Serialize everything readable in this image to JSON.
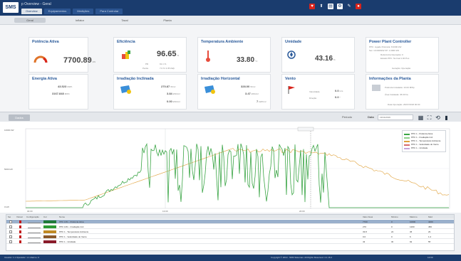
{
  "window": {
    "logo": "SMS",
    "title": "p Overview - Geral"
  },
  "nav": {
    "tabs": [
      "Overview",
      "Equipamentos",
      "Medições",
      "Para Controlar"
    ]
  },
  "subtabs": [
    "Geral",
    "Inflator",
    "Taxal",
    "Planta"
  ],
  "cards": {
    "potencia": {
      "title": "Potência Ativa",
      "value": "7700.89",
      "unit": "kW"
    },
    "eficiencia": {
      "title": "Eficiência",
      "value": "96.65",
      "unit": "%",
      "l1": "PR",
      "v1": "91.1 %",
      "l2": "Perda",
      "v2": "7.0 %  3.35 kWp"
    },
    "temperatura": {
      "title": "Temperatura Ambiente",
      "value": "33.80",
      "unit": "°C"
    },
    "umidade": {
      "title": "Umidade",
      "value": "43.16",
      "unit": "%"
    },
    "energia": {
      "title": "Energia Ativa",
      "v1": "43.523",
      "u1": "MWh",
      "v2": "3167.848",
      "u2": "MWh"
    },
    "irr_inc": {
      "title": "Irradiação Inclinada",
      "v1": "270.87",
      "u1": "W/m²",
      "v2": "3.84",
      "u2": "kWh/m²",
      "v3": "0.00",
      "u3": "kWh/m²"
    },
    "irr_hor": {
      "title": "Irradiação Horizontal",
      "v1": "328.00",
      "u1": "W/m²",
      "v2": "3.47",
      "u2": "kWh/m²",
      "v3": "7",
      "u3": "kWh/m²"
    },
    "vento": {
      "title": "Vento",
      "l1": "Velocidade",
      "v1": "0.0",
      "u1": "m/s",
      "l2": "Direção",
      "v2": "0.0",
      "u2": "°"
    },
    "ppc": {
      "title": "Power Plant Controller",
      "rows": [
        "PPC: Ligado   Potência: 8.0000 kW",
        "Set: 10.0000kW   FP: 1.0000 kW",
        "Referência Operação: 0",
        "Estado PPC: Normal 1.00 Pos"
      ],
      "footer": "Geração: Operação"
    },
    "info": {
      "title": "Informações da Planta",
      "rows": [
        "Potência Instalada: 10.00 MWp",
        "Área Instalada: 45.00 ha",
        "Data Operação: 26/07/2018 00:00"
      ]
    }
  },
  "chart_toolbar": {
    "data_button": "Dados",
    "date_label": "Data",
    "date_value": "13/11/2019",
    "period": "Período"
  },
  "chart_data": {
    "type": "line",
    "x": [
      "04:00",
      "13:00",
      "20:00"
    ],
    "series": [
      {
        "name": "PPC 1 - Potência Ativa",
        "color": "#3aa545"
      },
      {
        "name": "PPC 1 - Irradiação Incl.",
        "color": "#8ccf8a"
      },
      {
        "name": "PPC 1 - Temperatura Ambiente",
        "color": "#e0a13a"
      },
      {
        "name": "PPC 1 - Velocidade do Vento",
        "color": "#d66a6a"
      },
      {
        "name": "PPC 1 - Umidade",
        "color": "#c7a3d8"
      }
    ],
    "y_ticks": [
      "10000 kW",
      "5000 kW",
      "0 kW"
    ]
  },
  "grid": {
    "headers": [
      "Sel",
      "Visível",
      "Configuração",
      "Cor",
      "Nome",
      "Valor Atual",
      "Mínimo",
      "Máximo",
      "Méd"
    ],
    "rows": [
      {
        "name": "PPC 1/01 - Potência Ativa",
        "color": "#1f7a3a",
        "val": "7700",
        "min": "0",
        "max": "10000",
        "avg": "4460"
      },
      {
        "name": "PPC 1/01 - Irradiação Incl.",
        "color": "#2e9a35",
        "val": "270",
        "min": "0",
        "max": "1200",
        "avg": "450"
      },
      {
        "name": "PPC 1 - Temperatura Ambiente",
        "color": "#c08a24",
        "val": "33.8",
        "min": "22",
        "max": "36",
        "avg": "29"
      },
      {
        "name": "PPC 1 - Velocidade do Vento",
        "color": "#8b5a2b",
        "val": "0.0",
        "min": "0",
        "max": "6",
        "avg": "1.2"
      },
      {
        "name": "PPC 1 - Umidade",
        "color": "#8a1b2a",
        "val": "43",
        "min": "30",
        "max": "92",
        "avg": "55"
      }
    ]
  },
  "status": {
    "left": "Usuário: 1.1   Operador: 1.1   Alarme: 0",
    "right": "Copyright © 2019 - SMS Sistemas. All Rights Reserved. 4.1.16.2",
    "time": "12:00"
  },
  "colors": {
    "brand": "#1a3c6e",
    "accent": "#2a5a9a",
    "selected": "#9ab0cc"
  }
}
